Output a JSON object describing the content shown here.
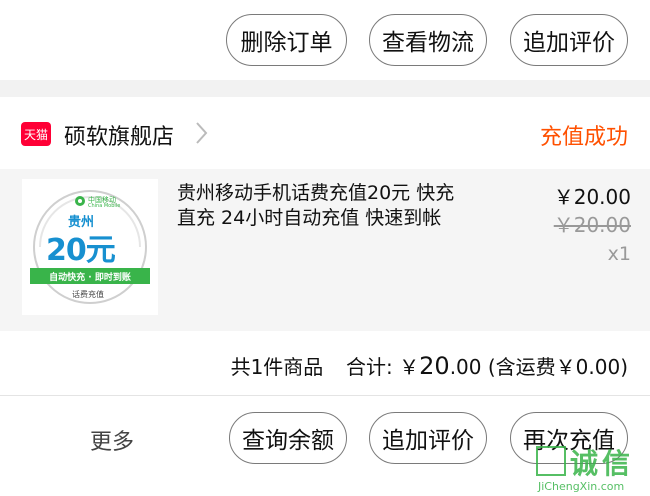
{
  "top_actions": {
    "delete_order": "删除订单",
    "view_logistics": "查看物流",
    "add_review": "追加评价"
  },
  "store": {
    "badge": "天猫",
    "name": "硕软旗舰店",
    "status": "充值成功"
  },
  "product": {
    "title_line1": "贵州移动手机话费充值20元 快充",
    "title_line2": "直充 24小时自动充值 快速到帐",
    "price": "￥20.00",
    "original_price": "￥20.00",
    "quantity": "x1",
    "thumb": {
      "carrier": "中国移动",
      "carrier_en": "China Mobile",
      "region": "贵州",
      "amount": "20元",
      "banner": "自动快充 · 即时到账",
      "caption": "话费充值"
    }
  },
  "summary": {
    "count_label": "共1件商品",
    "total_label": "合计: ￥",
    "total_int": "20",
    "total_dec": ".00",
    "shipping": "(含运费￥0.00)"
  },
  "bottom_actions": {
    "more": "更多",
    "check_balance": "查询余额",
    "add_review": "追加评价",
    "recharge_again": "再次充值"
  },
  "watermark": {
    "brand": "诚信",
    "url": "JiChengXin.com"
  },
  "colors": {
    "status_orange": "#ff5000",
    "tmall_red": "#ff0036",
    "thumb_green": "#39b44a",
    "thumb_blue": "#1790d0"
  }
}
